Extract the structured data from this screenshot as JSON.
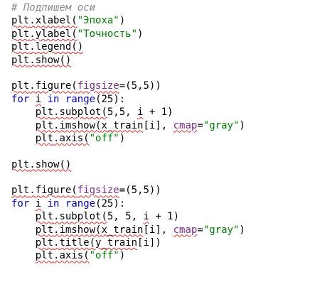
{
  "editor": {
    "lines": [
      [
        {
          "t": "# Подпишем оси",
          "c": "comment",
          "name": "comment-text"
        }
      ],
      [
        {
          "t": "plt",
          "sq": true
        },
        {
          "t": ".xlabel(",
          "sq": true
        },
        {
          "t": "\"Эпоха\"",
          "c": "str"
        },
        {
          "t": ")"
        }
      ],
      [
        {
          "t": "plt",
          "sq": true
        },
        {
          "t": ".ylabel(",
          "sq": true
        },
        {
          "t": "\"Точность\"",
          "c": "str"
        },
        {
          "t": ")"
        }
      ],
      [
        {
          "t": "plt",
          "sq": true
        },
        {
          "t": ".legend()",
          "sq": true
        }
      ],
      [
        {
          "t": "plt",
          "sq": true
        },
        {
          "t": ".show()",
          "sq": true
        }
      ],
      [],
      [
        {
          "t": "plt",
          "sq": true
        },
        {
          "t": ".figure(",
          "sq": true
        },
        {
          "t": "figsize",
          "c": "param",
          "sq": true
        },
        {
          "t": "=(5,5))"
        }
      ],
      [
        {
          "t": "for",
          "c": "kw"
        },
        {
          "t": " "
        },
        {
          "t": "i",
          "sq": true
        },
        {
          "t": " "
        },
        {
          "t": "in",
          "c": "kw"
        },
        {
          "t": " "
        },
        {
          "t": "range",
          "c": "kw"
        },
        {
          "t": "(25):"
        }
      ],
      [
        {
          "t": "    "
        },
        {
          "t": "plt",
          "sq": true
        },
        {
          "t": ".subplot(",
          "sq": true
        },
        {
          "t": "5,5, "
        },
        {
          "t": "i",
          "sq": true
        },
        {
          "t": " + 1)"
        }
      ],
      [
        {
          "t": "    "
        },
        {
          "t": "plt",
          "sq": true
        },
        {
          "t": ".imshow(",
          "sq": true
        },
        {
          "t": "x_train",
          "sq": true
        },
        {
          "t": "[i], "
        },
        {
          "t": "cmap",
          "c": "param",
          "sq": true
        },
        {
          "t": "="
        },
        {
          "t": "\"gray\"",
          "c": "str"
        },
        {
          "t": ")"
        }
      ],
      [
        {
          "t": "    "
        },
        {
          "t": "plt",
          "sq": true
        },
        {
          "t": ".axis(",
          "sq": true
        },
        {
          "t": "\"off\"",
          "c": "str"
        },
        {
          "t": ")"
        }
      ],
      [],
      [
        {
          "t": "plt",
          "sq": true
        },
        {
          "t": ".show()",
          "sq": true
        }
      ],
      [],
      [
        {
          "t": "plt",
          "sq": true
        },
        {
          "t": ".figure(",
          "sq": true
        },
        {
          "t": "figsize",
          "c": "param",
          "sq": true
        },
        {
          "t": "=(5,5))"
        }
      ],
      [
        {
          "t": "for",
          "c": "kw"
        },
        {
          "t": " "
        },
        {
          "t": "i",
          "sq": true
        },
        {
          "t": " "
        },
        {
          "t": "in",
          "c": "kw"
        },
        {
          "t": " "
        },
        {
          "t": "range",
          "c": "kw"
        },
        {
          "t": "(25):"
        }
      ],
      [
        {
          "t": "    "
        },
        {
          "t": "plt",
          "sq": true
        },
        {
          "t": ".subplot(",
          "sq": true
        },
        {
          "t": "5, 5, "
        },
        {
          "t": "i",
          "sq": true
        },
        {
          "t": " + 1)"
        }
      ],
      [
        {
          "t": "    "
        },
        {
          "t": "plt",
          "sq": true
        },
        {
          "t": ".imshow(",
          "sq": true
        },
        {
          "t": "x_train",
          "sq": true
        },
        {
          "t": "[i], "
        },
        {
          "t": "cmap",
          "c": "param",
          "sq": true
        },
        {
          "t": "="
        },
        {
          "t": "\"gray\"",
          "c": "str"
        },
        {
          "t": ")"
        }
      ],
      [
        {
          "t": "    "
        },
        {
          "t": "plt",
          "sq": true
        },
        {
          "t": ".title(",
          "sq": true
        },
        {
          "t": "y_train",
          "sq": true
        },
        {
          "t": "[i])"
        }
      ],
      [
        {
          "t": "    "
        },
        {
          "t": "plt",
          "sq": true
        },
        {
          "t": ".axis(",
          "sq": true
        },
        {
          "t": "\"off\"",
          "c": "str"
        },
        {
          "t": ")"
        }
      ]
    ]
  }
}
